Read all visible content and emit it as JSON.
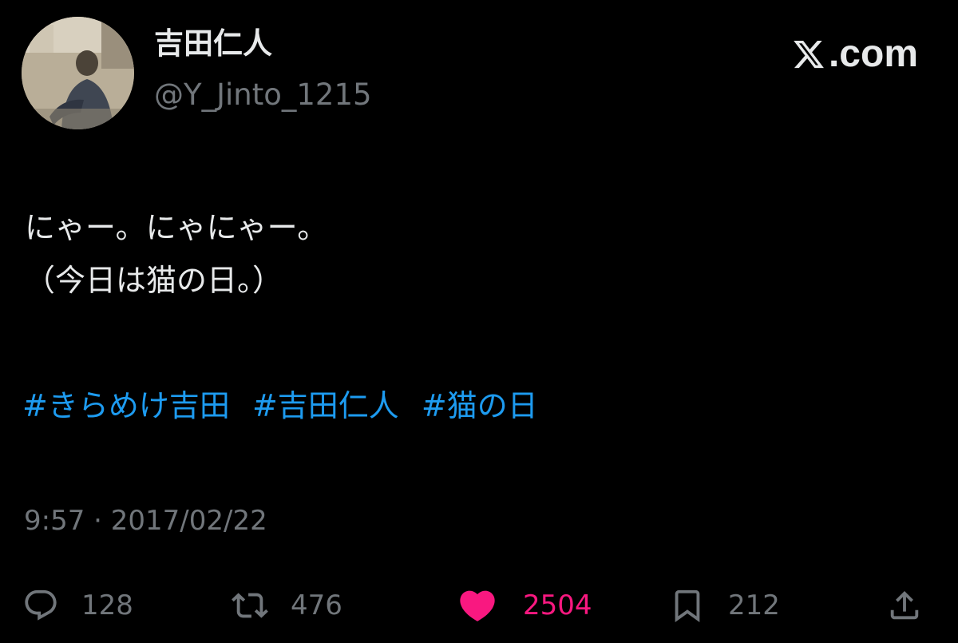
{
  "author": {
    "display_name": "吉田仁人",
    "handle": "@Y_Jinto_1215"
  },
  "brand": {
    "label": ".com",
    "icon": "x-logo-icon"
  },
  "tweet": {
    "lines": [
      "にゃー。にゃにゃー。",
      "（今日は猫の日。）"
    ],
    "hashtags": [
      "#きらめけ吉田",
      "#吉田仁人",
      "#猫の日"
    ],
    "timestamp": "9:57 · 2017/02/22"
  },
  "actions": {
    "reply": {
      "icon": "reply-icon",
      "count": "128"
    },
    "retweet": {
      "icon": "retweet-icon",
      "count": "476"
    },
    "like": {
      "icon": "heart-icon",
      "count": "2504",
      "active": true,
      "color": "#f91880"
    },
    "bookmark": {
      "icon": "bookmark-icon",
      "count": "212"
    },
    "share": {
      "icon": "share-icon"
    }
  },
  "colors": {
    "background": "#000000",
    "primary_text": "#e7e9ea",
    "secondary_text": "#71767b",
    "hashtag": "#1d9bf0",
    "like": "#f91880"
  }
}
